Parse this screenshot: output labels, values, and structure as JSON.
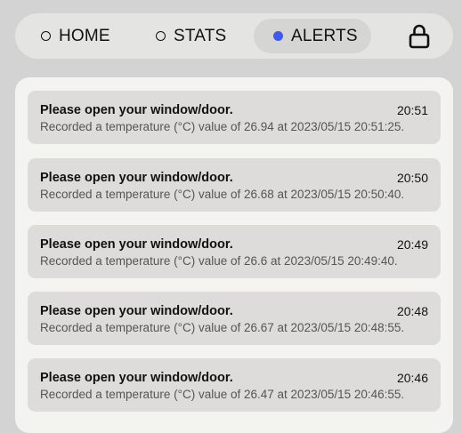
{
  "nav": {
    "tabs": [
      {
        "label": "HOME",
        "active": false
      },
      {
        "label": "STATS",
        "active": false
      },
      {
        "label": "ALERTS",
        "active": true
      }
    ],
    "lock_icon": "lock-icon",
    "active_dot_color": "#3d5af1"
  },
  "alerts": [
    {
      "title": "Please open your window/door.",
      "time": "20:51",
      "message": "Recorded a temperature (°C) value of 26.94 at 2023/05/15 20:51:25."
    },
    {
      "title": "Please open your window/door.",
      "time": "20:50",
      "message": "Recorded a temperature (°C) value of 26.68 at 2023/05/15 20:50:40."
    },
    {
      "title": "Please open your window/door.",
      "time": "20:49",
      "message": "Recorded a temperature (°C) value of 26.6 at 2023/05/15 20:49:40."
    },
    {
      "title": "Please open your window/door.",
      "time": "20:48",
      "message": "Recorded a temperature (°C) value of 26.67 at 2023/05/15 20:48:55."
    },
    {
      "title": "Please open your window/door.",
      "time": "20:46",
      "message": "Recorded a temperature (°C) value of 26.47 at 2023/05/15 20:46:55."
    }
  ]
}
